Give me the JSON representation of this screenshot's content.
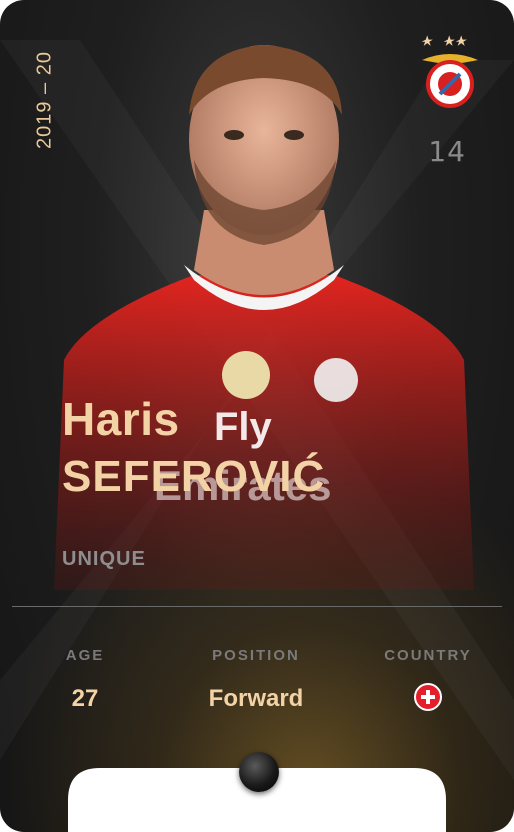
{
  "card": {
    "season": "2019 – 20",
    "serial": "14",
    "first_name": "Haris",
    "last_name": "SEFEROVIĆ",
    "rarity": "UNIQUE",
    "stats": [
      {
        "label": "AGE",
        "value": "27"
      },
      {
        "label": "POSITION",
        "value": "Forward"
      },
      {
        "label": "COUNTRY",
        "value": ""
      }
    ],
    "club_crest_icon": "benfica-crest-icon",
    "country_flag_icon": "switzerland-flag-icon",
    "accent_color": "#f3d2a5",
    "season_color": "#e9c89a",
    "shirt_color": "#d8201e"
  }
}
